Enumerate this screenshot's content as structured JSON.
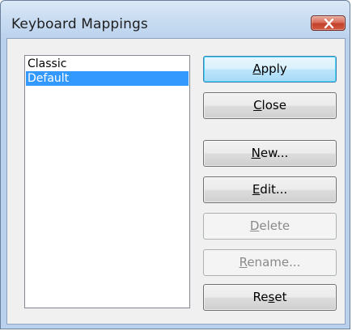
{
  "window": {
    "title": "Keyboard Mappings"
  },
  "list": {
    "items": [
      {
        "label": "Classic",
        "selected": false
      },
      {
        "label": "Default",
        "selected": true
      }
    ]
  },
  "buttons": {
    "apply": {
      "mnemonic": "A",
      "rest": "pply",
      "enabled": true
    },
    "close": {
      "mnemonic": "C",
      "rest": "lose",
      "enabled": true
    },
    "new": {
      "mnemonic": "N",
      "rest": "ew...",
      "enabled": true
    },
    "edit": {
      "mnemonic": "E",
      "rest": "dit...",
      "enabled": true
    },
    "delete": {
      "mnemonic": "D",
      "rest": "elete",
      "enabled": false
    },
    "rename": {
      "mnemonic": "R",
      "rest": "ename...",
      "enabled": false
    },
    "reset": {
      "pre": "Re",
      "mnemonic": "s",
      "rest": "et",
      "enabled": true
    }
  },
  "colors": {
    "selection": "#3399ff",
    "close_button": "#c2412a"
  },
  "icons": {
    "close": "close-x-icon"
  }
}
